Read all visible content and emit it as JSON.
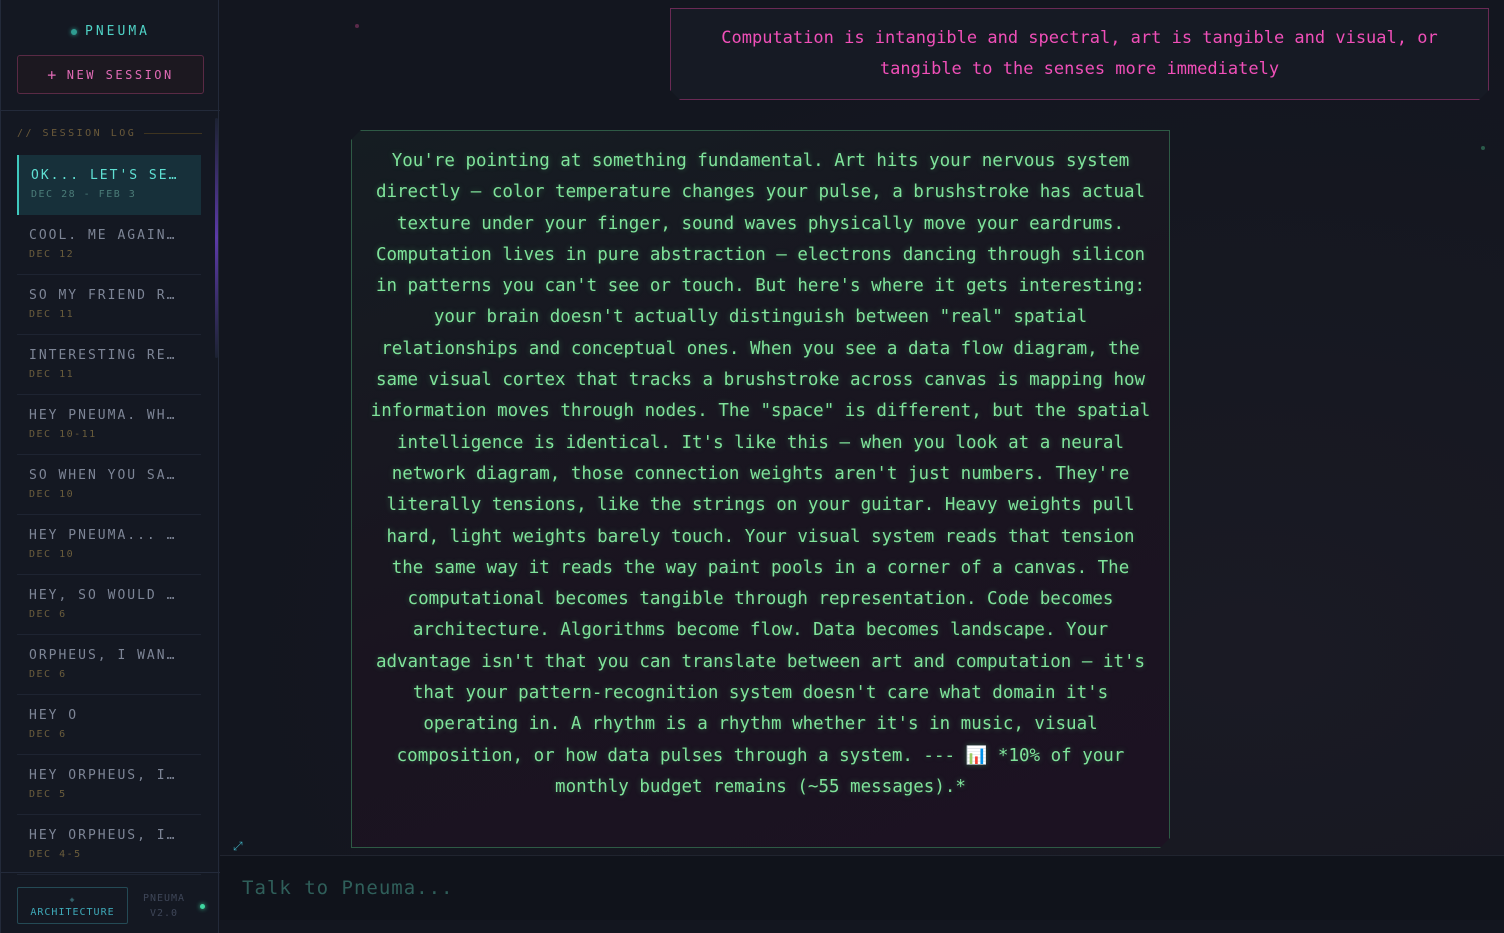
{
  "app": {
    "brand": "PNEUMA",
    "new_session_label": "NEW SESSION",
    "new_session_icon": "+"
  },
  "sidebar": {
    "log_header": "// SESSION LOG",
    "sessions": [
      {
        "title": "OK... LET'S SEE…",
        "date": "DEC 28 - FEB 3",
        "active": true
      },
      {
        "title": "COOL. ME AGAIN.…",
        "date": "DEC 12"
      },
      {
        "title": "SO MY FRIEND RE…",
        "date": "DEC 11"
      },
      {
        "title": "INTERESTING REP…",
        "date": "DEC 11"
      },
      {
        "title": "HEY PNEUMA. WHA…",
        "date": "DEC 10-11"
      },
      {
        "title": "SO WHEN YOU SAY…",
        "date": "DEC 10"
      },
      {
        "title": "HEY PNEUMA... N…",
        "date": "DEC 10"
      },
      {
        "title": "HEY, SO WOULD Y…",
        "date": "DEC 6"
      },
      {
        "title": "ORPHEUS, I WANT…",
        "date": "DEC 6"
      },
      {
        "title": "HEY O",
        "date": "DEC 6"
      },
      {
        "title": "HEY ORPHEUS, I'…",
        "date": "DEC 5"
      },
      {
        "title": "HEY ORPHEUS, IT…",
        "date": "DEC 4-5"
      }
    ],
    "architecture_icon": "◈",
    "architecture_label": "ARCHITECTURE",
    "version_name": "PNEUMA",
    "version_number": "V2.0"
  },
  "conversation": {
    "user_message": "Computation is intangible and spectral, art is tangible and visual, or tangible to the senses more immediately",
    "assistant_message": "You're pointing at something fundamental. Art hits your nervous system directly — color temperature changes your pulse, a brushstroke has actual texture under your finger, sound waves physically move your eardrums. Computation lives in pure abstraction — electrons dancing through silicon in patterns you can't see or touch. But here's where it gets interesting: your brain doesn't actually distinguish between \"real\" spatial relationships and conceptual ones. When you see a data flow diagram, the same visual cortex that tracks a brushstroke across canvas is mapping how information moves through nodes. The \"space\" is different, but the spatial intelligence is identical. It's like this — when you look at a neural network diagram, those connection weights aren't just numbers. They're literally tensions, like the strings on your guitar. Heavy weights pull hard, light weights barely touch. Your visual system reads that tension the same way it reads the way paint pools in a corner of a canvas. The computational becomes tangible through representation. Code becomes architecture. Algorithms become flow. Data becomes landscape. Your advantage isn't that you can translate between art and computation — it's that your pattern-recognition system doesn't care what domain it's operating in. A rhythm is a rhythm whether it's in music, visual composition, or how data pulses through a system. --- 📊 *10% of your monthly budget remains (~55 messages).*"
  },
  "input": {
    "placeholder": "Talk to Pneuma...",
    "value": ""
  },
  "icons": {
    "expand": "expand-icon",
    "status": "online-status-dot"
  },
  "colors": {
    "accent_teal": "#4fd1c5",
    "accent_pink": "#f04fb8",
    "assistant_green": "#7fe39a"
  }
}
